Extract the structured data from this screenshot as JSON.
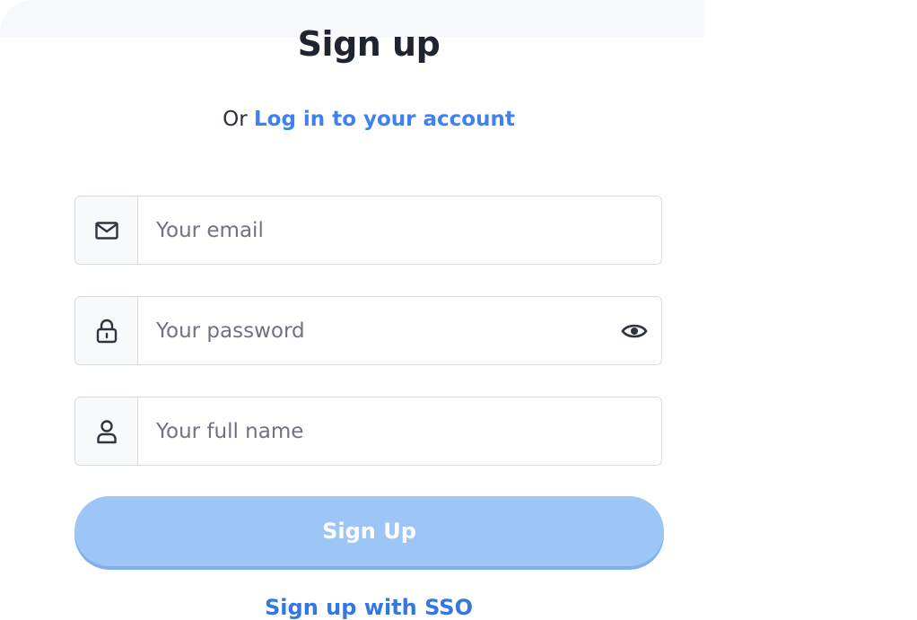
{
  "header": {
    "title": "Sign up",
    "subtitle_prefix": "Or",
    "login_link": "Log in to your account"
  },
  "form": {
    "email": {
      "placeholder": "Your email",
      "value": "",
      "icon": "mail-icon"
    },
    "password": {
      "placeholder": "Your password",
      "value": "",
      "icon": "lock-icon",
      "toggle_icon": "eye-icon"
    },
    "full_name": {
      "placeholder": "Your full name",
      "value": "",
      "icon": "user-icon"
    },
    "submit_label": "Sign Up",
    "sso_label": "Sign up with SSO"
  },
  "colors": {
    "link": "#3f82ef",
    "button": "#9dc6f7",
    "title": "#1f2431"
  }
}
